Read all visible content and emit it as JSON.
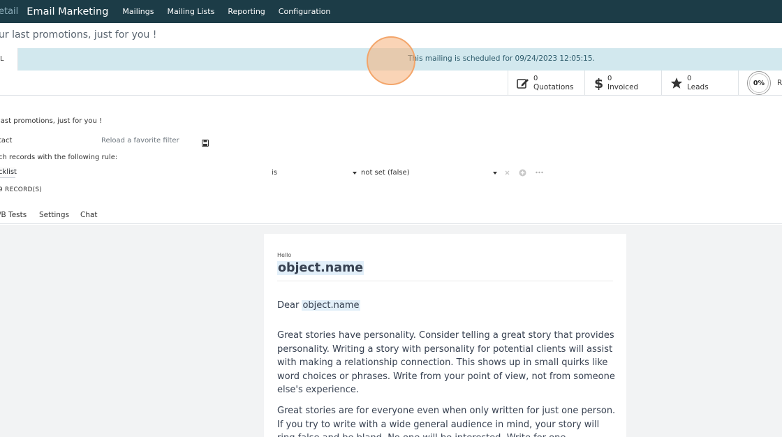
{
  "navbar": {
    "prev_app": "etail",
    "app_name": "Email Marketing",
    "menu": [
      "Mailings",
      "Mailing Lists",
      "Reporting",
      "Configuration"
    ]
  },
  "breadcrumb": "ur last promotions, just for you !",
  "banner": {
    "tab_label": "L",
    "message": "This mailing is scheduled for 09/24/2023 12:05:15."
  },
  "stats": [
    {
      "value": "0",
      "label": "Quotations",
      "icon": "edit-icon"
    },
    {
      "value": "0",
      "label": "Invoiced",
      "icon": "dollar-icon"
    },
    {
      "value": "0",
      "label": "Leads",
      "icon": "star-icon"
    }
  ],
  "ring": {
    "percent": "0%",
    "label_cut": "R"
  },
  "form": {
    "subject": "last promotions, just for you !",
    "recipients": "tact",
    "favorite_filter": "Reload a favorite filter",
    "rule_intro": "ch records with the following rule:",
    "rule_field": "cklist",
    "rule_operator": "is",
    "rule_value": "not set (false)",
    "records": "9 RECORD(S)"
  },
  "tabs": [
    "/B Tests",
    "Settings",
    "Chat"
  ],
  "email": {
    "greeting": "Hello",
    "title": "object.name",
    "dear": "Dear",
    "dear_token": "object.name",
    "para1": "Great stories have personality. Consider telling a great story that provides personality. Writing a story with personality for potential clients will assist with making a relationship connection. This shows up in small quirks like word choices or phrases. Write from your point of view, not from someone else's experience.",
    "para2": "Great stories are for everyone even when only written for just one person. If you try to write with a wide general audience in mind, your story will ring false and be bland. No one will be interested. Write for one"
  },
  "colors": {
    "navbar": "#1c3c47",
    "banner": "#d2e8ee",
    "token_highlight": "#e2eff9",
    "tour_circle": "#f3a56a"
  }
}
